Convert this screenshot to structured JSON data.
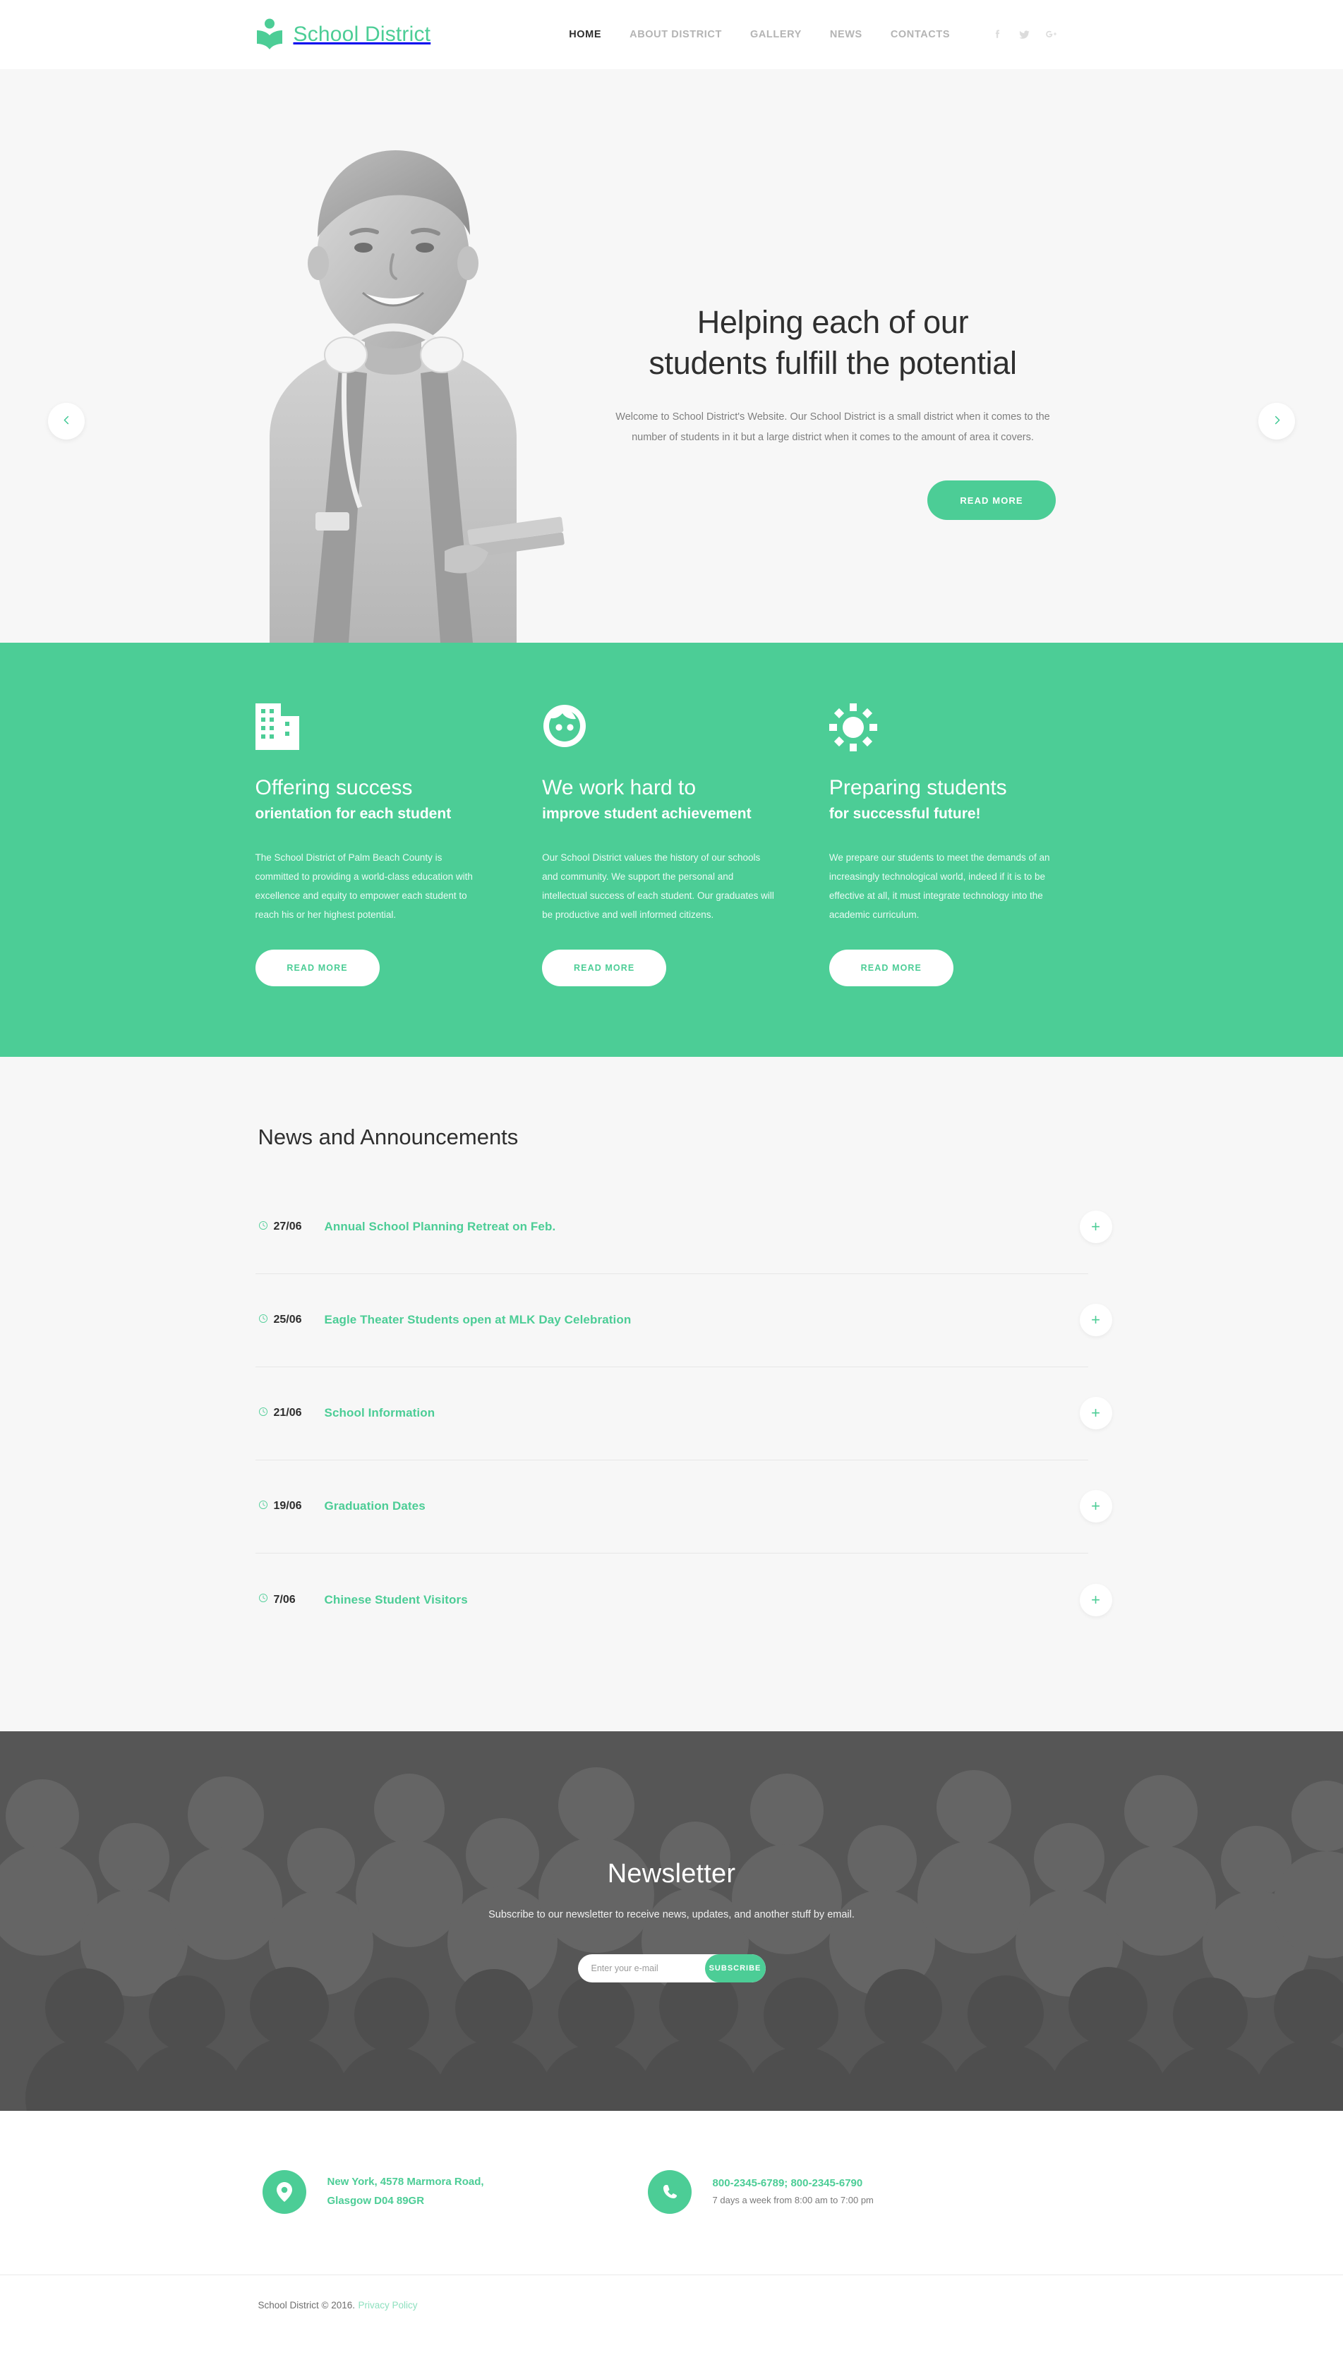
{
  "header": {
    "brand": "School District",
    "logo_icon": "book-reader-icon",
    "nav": [
      {
        "label": "HOME",
        "active": true
      },
      {
        "label": "ABOUT DISTRICT",
        "active": false
      },
      {
        "label": "GALLERY",
        "active": false
      },
      {
        "label": "NEWS",
        "active": false
      },
      {
        "label": "CONTACTS",
        "active": false
      }
    ],
    "social": [
      {
        "name": "facebook-icon"
      },
      {
        "name": "twitter-icon"
      },
      {
        "name": "google-plus-icon"
      }
    ]
  },
  "hero": {
    "title_line1": "Helping each of our",
    "title_line2": "students fulfill the potential",
    "paragraph": "Welcome to School District's Website. Our School District is a small district when it comes to the number of students in it but a large district when it comes to the amount of area it covers.",
    "cta_label": "READ MORE",
    "prev_label": "Previous slide",
    "next_label": "Next slide"
  },
  "features": {
    "accent": "#4ccd96",
    "items": [
      {
        "icon": "building-icon",
        "title": "Offering success",
        "subtitle": "orientation for each student",
        "text": "The School District of Palm Beach County is committed to providing a world-class education with excellence and equity to empower each student to reach his or her highest potential.",
        "button": "READ MORE"
      },
      {
        "icon": "child-face-icon",
        "title": "We work hard to",
        "subtitle": "improve student achievement",
        "text": "Our School District values the history of our schools and community. We support the personal and intellectual success of each student. Our graduates will be productive and well informed citizens.",
        "button": "READ MORE"
      },
      {
        "icon": "sun-icon",
        "title": "Preparing students",
        "subtitle": "for successful future!",
        "text": "We prepare our students to meet the demands of an increasingly technological world, indeed if it is to be effective at all, it must integrate technology into the academic curriculum.",
        "button": "READ MORE"
      }
    ]
  },
  "news": {
    "heading": "News and Announcements",
    "expand_label": "+",
    "items": [
      {
        "date": "27/06",
        "title": "Annual School Planning Retreat on Feb."
      },
      {
        "date": "25/06",
        "title": "Eagle Theater Students open at MLK Day Celebration"
      },
      {
        "date": "21/06",
        "title": "School Information"
      },
      {
        "date": "19/06",
        "title": "Graduation Dates"
      },
      {
        "date": "7/06",
        "title": "Chinese Student Visitors"
      }
    ]
  },
  "newsletter": {
    "title": "Newsletter",
    "subtitle": "Subscribe to our newsletter to receive news, updates, and another stuff by email.",
    "placeholder": "Enter your e-mail",
    "input_value": "",
    "submit_label": "SUBSCRIBE"
  },
  "contacts": {
    "address": {
      "icon": "map-pin-icon",
      "line1": "New York, 4578 Marmora Road,",
      "line2": "Glasgow D04 89GR"
    },
    "phone": {
      "icon": "phone-icon",
      "numbers": "800-2345-6789; 800-2345-6790",
      "hours": "7 days a week from 8:00 am to 7:00 pm"
    }
  },
  "footer": {
    "copyright": "School District © 2016.",
    "privacy_label": "Privacy Policy"
  }
}
